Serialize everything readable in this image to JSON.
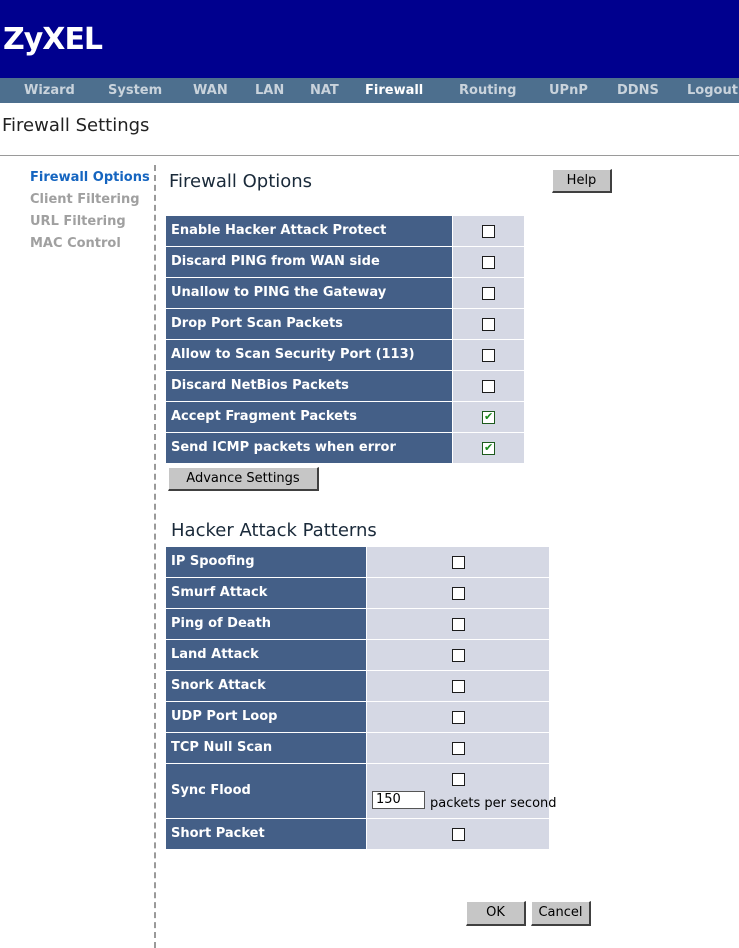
{
  "brand": {
    "logo": "ZyXEL"
  },
  "nav": {
    "items": [
      {
        "label": "Wizard",
        "active": false
      },
      {
        "label": "System",
        "active": false
      },
      {
        "label": "WAN",
        "active": false
      },
      {
        "label": "LAN",
        "active": false
      },
      {
        "label": "NAT",
        "active": false
      },
      {
        "label": "Firewall",
        "active": true
      },
      {
        "label": "Routing",
        "active": false
      },
      {
        "label": "UPnP",
        "active": false
      },
      {
        "label": "DDNS",
        "active": false
      },
      {
        "label": "Logout",
        "active": false
      }
    ]
  },
  "page_title": "Firewall Settings",
  "sidebar": {
    "items": [
      {
        "label": "Firewall Options",
        "active": true
      },
      {
        "label": "Client Filtering",
        "active": false
      },
      {
        "label": "URL Filtering",
        "active": false
      },
      {
        "label": "MAC Control",
        "active": false
      }
    ]
  },
  "options": {
    "title": "Firewall Options",
    "help_label": "Help",
    "rows": [
      {
        "label": "Enable Hacker Attack Protect",
        "checked": false
      },
      {
        "label": "Discard PING from WAN side",
        "checked": false
      },
      {
        "label": "Unallow to PING the Gateway",
        "checked": false
      },
      {
        "label": "Drop Port Scan Packets",
        "checked": false
      },
      {
        "label": "Allow to Scan Security Port (113)",
        "checked": false
      },
      {
        "label": "Discard NetBios Packets",
        "checked": false
      },
      {
        "label": "Accept Fragment Packets",
        "checked": true
      },
      {
        "label": "Send ICMP packets when error",
        "checked": true
      }
    ],
    "advance_label": "Advance Settings"
  },
  "patterns": {
    "title": "Hacker Attack Patterns",
    "rows": [
      {
        "label": "IP Spoofing",
        "checked": false
      },
      {
        "label": "Smurf Attack",
        "checked": false
      },
      {
        "label": "Ping of Death",
        "checked": false
      },
      {
        "label": "Land Attack",
        "checked": false
      },
      {
        "label": "Snork Attack",
        "checked": false
      },
      {
        "label": "UDP Port Loop",
        "checked": false
      },
      {
        "label": "TCP Null Scan",
        "checked": false
      },
      {
        "label": "Sync Flood",
        "checked": false
      },
      {
        "label": "Short Packet",
        "checked": false
      }
    ],
    "sync_flood": {
      "rate_value": "150",
      "unit": "packets per second"
    }
  },
  "footer": {
    "ok_label": "OK",
    "cancel_label": "Cancel"
  }
}
